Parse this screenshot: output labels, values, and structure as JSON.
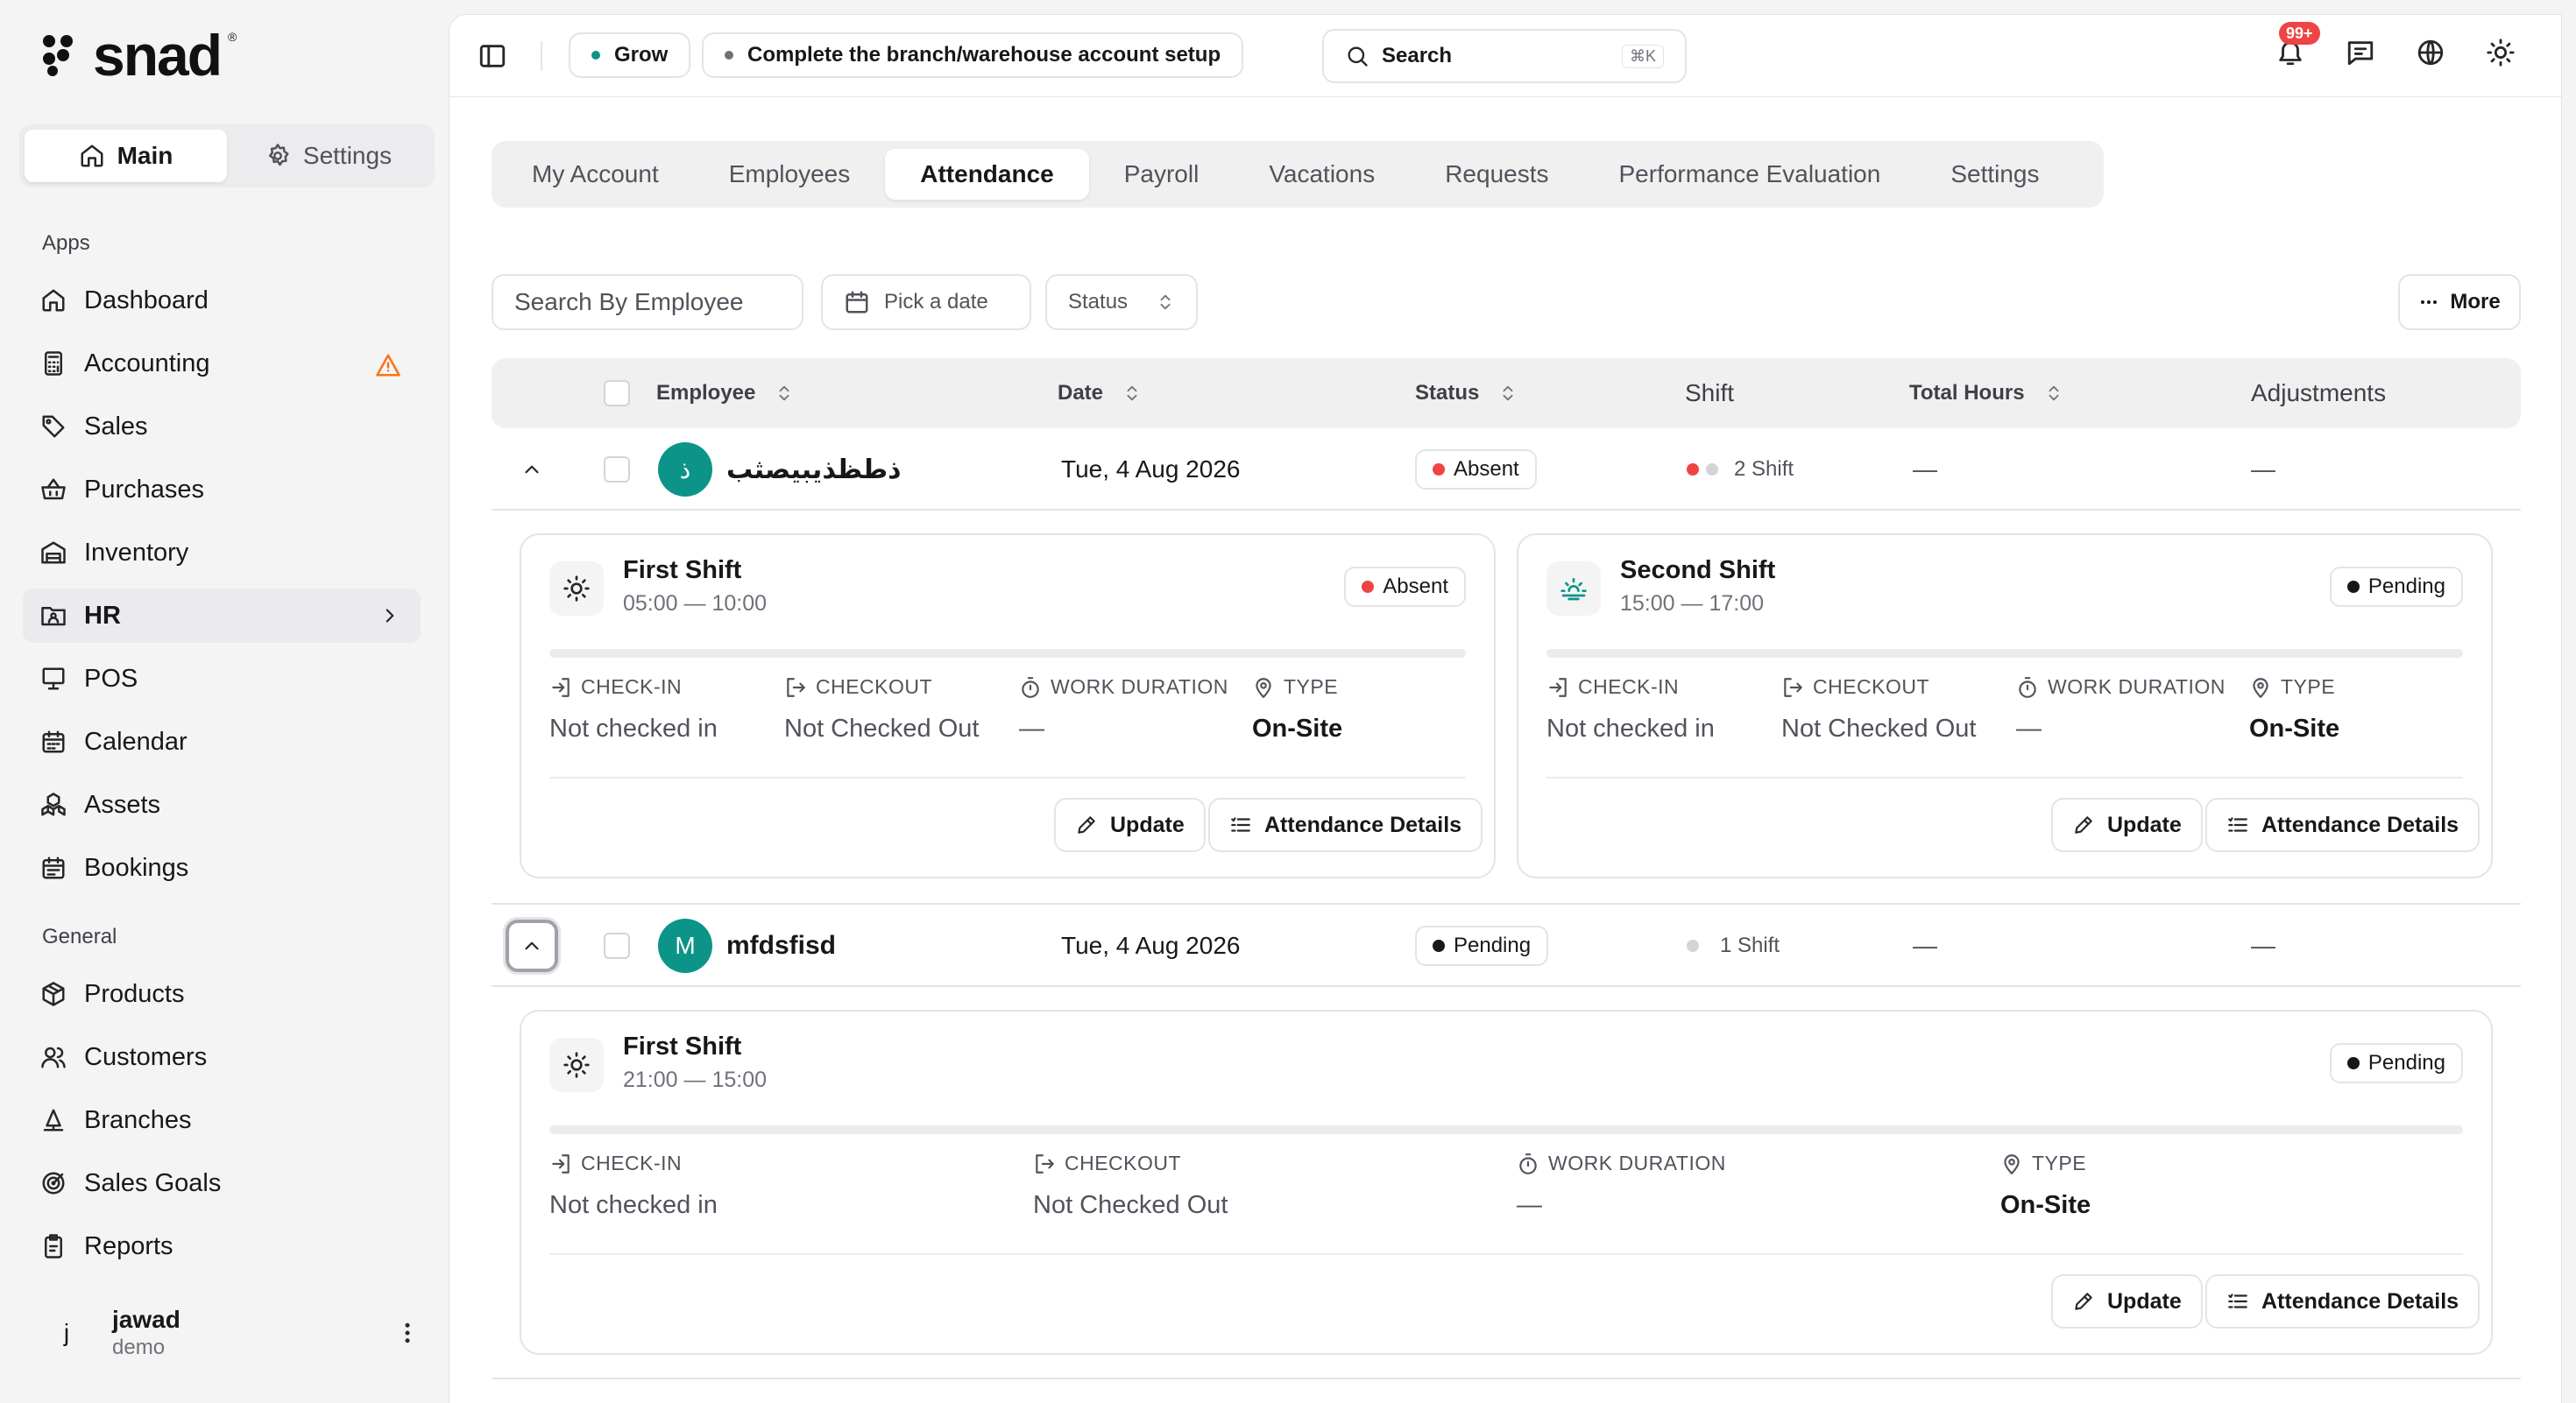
{
  "app": {
    "logo": "snad"
  },
  "sidebar": {
    "mode_tabs": [
      {
        "label": "Main",
        "icon": "home-icon"
      },
      {
        "label": "Settings",
        "icon": "gear-icon"
      }
    ],
    "groups": [
      {
        "label": "Apps",
        "items": [
          {
            "label": "Dashboard",
            "icon": "home-icon"
          },
          {
            "label": "Accounting",
            "icon": "calculator-icon",
            "alert": "warning-icon"
          },
          {
            "label": "Sales",
            "icon": "tag-icon"
          },
          {
            "label": "Purchases",
            "icon": "basket-icon"
          },
          {
            "label": "Inventory",
            "icon": "warehouse-icon"
          },
          {
            "label": "HR",
            "icon": "users-folder-icon",
            "trail": "chevron-right-icon"
          },
          {
            "label": "POS",
            "icon": "monitor-icon"
          },
          {
            "label": "Calendar",
            "icon": "calendar-icon"
          },
          {
            "label": "Assets",
            "icon": "boxes-icon"
          },
          {
            "label": "Bookings",
            "icon": "calendar-check-icon"
          }
        ]
      },
      {
        "label": "General",
        "items": [
          {
            "label": "Products",
            "icon": "package-icon"
          },
          {
            "label": "Customers",
            "icon": "users-icon"
          },
          {
            "label": "Branches",
            "icon": "branch-icon"
          },
          {
            "label": "Sales Goals",
            "icon": "target-icon"
          },
          {
            "label": "Reports",
            "icon": "clipboard-icon"
          }
        ]
      }
    ],
    "user": {
      "initial": "j",
      "name": "jawad",
      "role": "demo"
    }
  },
  "topbar": {
    "grow_label": "Grow",
    "setup_label": "Complete the branch/warehouse account setup",
    "search_label": "Search",
    "search_shortcut": "⌘K",
    "notification_badge": "99+"
  },
  "tabs": [
    "My Account",
    "Employees",
    "Attendance",
    "Payroll",
    "Vacations",
    "Requests",
    "Performance Evaluation",
    "Settings"
  ],
  "active_tab": "Attendance",
  "filters": {
    "employee_placeholder": "Search By Employee",
    "date_label": "Pick a date",
    "status_label": "Status",
    "more_label": "More"
  },
  "table": {
    "headers": {
      "employee": "Employee",
      "date": "Date",
      "status": "Status",
      "shift": "Shift",
      "total_hours": "Total Hours",
      "adjustments": "Adjustments"
    },
    "metric_labels": {
      "checkin": "CHECK-IN",
      "checkout": "CHECKOUT",
      "duration": "WORK DURATION",
      "type": "TYPE"
    },
    "action_labels": {
      "update": "Update",
      "details": "Attendance Details"
    },
    "rows": [
      {
        "initial": "ذ",
        "name": "ذطظذيبيصثب",
        "date": "Tue, 4 Aug 2026",
        "status": "Absent",
        "shift_label": "2 Shift",
        "total_hours": "—",
        "adjustments": "—",
        "shifts": [
          {
            "title": "First Shift",
            "time": "05:00 — 10:00",
            "status": "Absent",
            "icon": "sun-icon",
            "checkin": "Not checked in",
            "checkout": "Not Checked Out",
            "duration": "—",
            "type": "On-Site"
          },
          {
            "title": "Second Shift",
            "time": "15:00 — 17:00",
            "status": "Pending",
            "icon": "sunset-icon",
            "checkin": "Not checked in",
            "checkout": "Not Checked Out",
            "duration": "—",
            "type": "On-Site"
          }
        ]
      },
      {
        "initial": "M",
        "name": "mfdsfisd",
        "date": "Tue, 4 Aug 2026",
        "status": "Pending",
        "shift_label": "1 Shift",
        "total_hours": "—",
        "adjustments": "—",
        "shifts": [
          {
            "title": "First Shift",
            "time": "21:00 — 15:00",
            "status": "Pending",
            "icon": "sun-icon",
            "checkin": "Not checked in",
            "checkout": "Not Checked Out",
            "duration": "—",
            "type": "On-Site"
          }
        ]
      }
    ]
  },
  "colors": {
    "brand": "#0d9488",
    "absent": "#ef4444",
    "pending": "#18181b",
    "warning": "#f97316"
  }
}
